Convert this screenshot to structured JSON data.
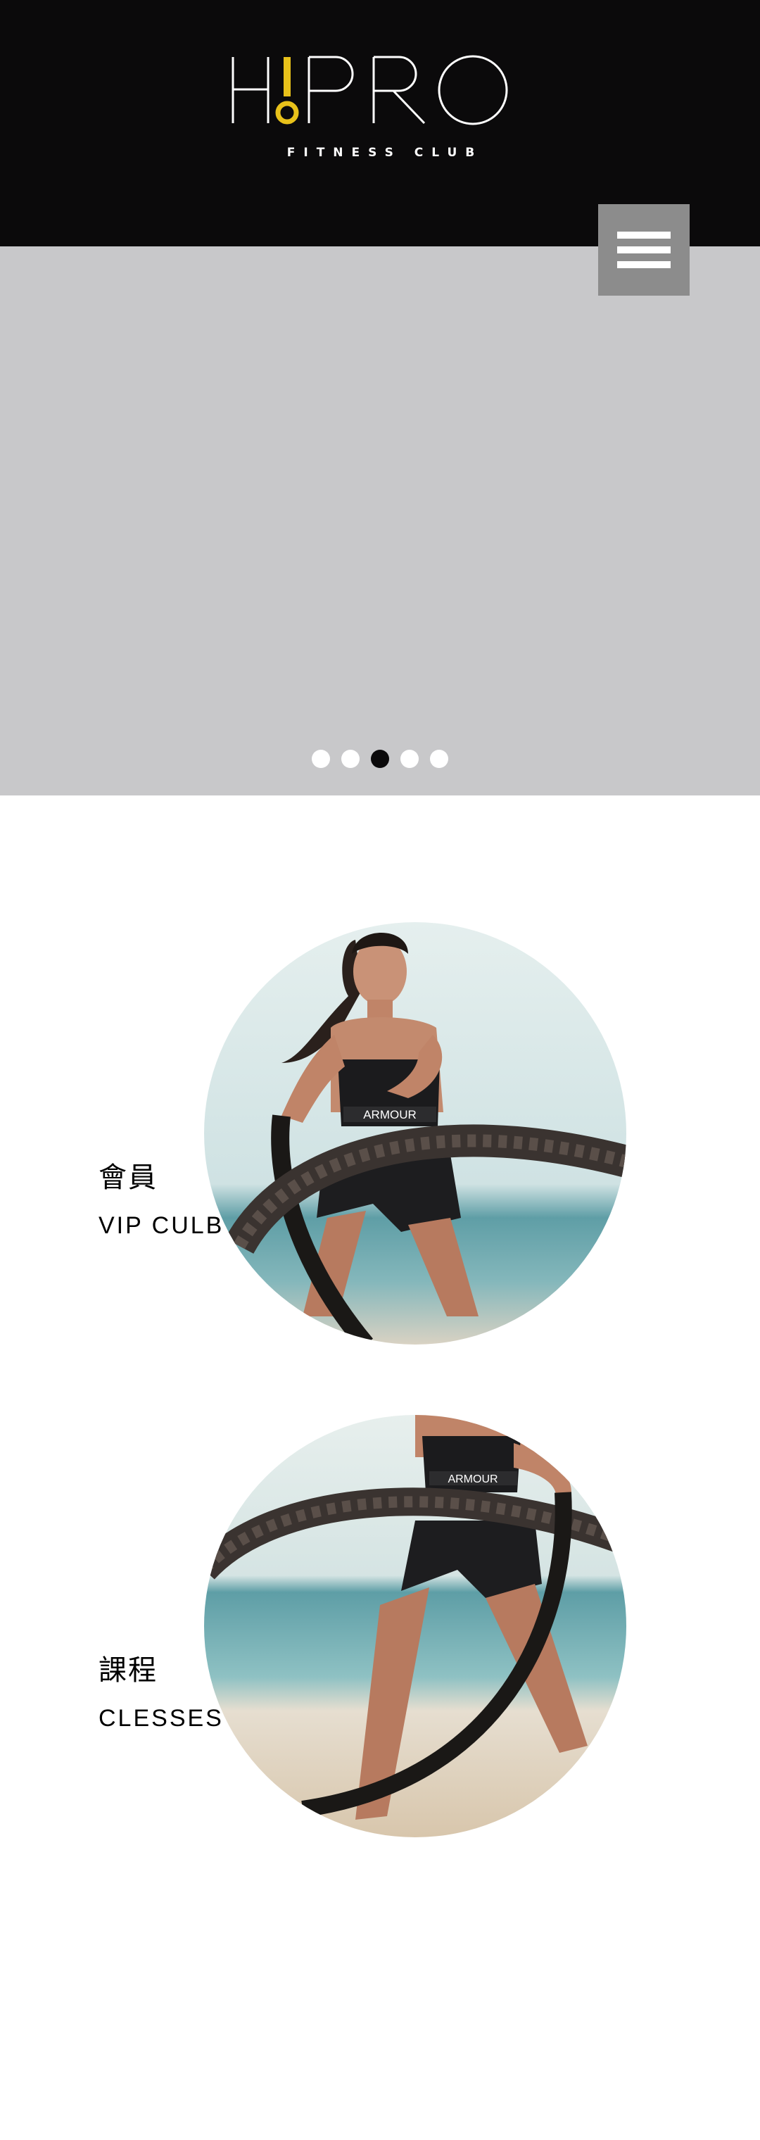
{
  "brand": {
    "logo_text": "H!PRO",
    "tagline": "FITNESS CLUB",
    "accent_color": "#e8c11a",
    "header_bg": "#0b0a0b"
  },
  "menu": {
    "icon": "hamburger-menu-icon"
  },
  "hero": {
    "background": "#c8c8ca",
    "slide_count": 5,
    "active_slide": 3
  },
  "features": [
    {
      "title_zh": "會員",
      "title_en": "VIP CULB",
      "image": "battle-rope-athlete-upper"
    },
    {
      "title_zh": "課程",
      "title_en": "CLESSES",
      "image": "battle-rope-athlete-lower"
    }
  ]
}
